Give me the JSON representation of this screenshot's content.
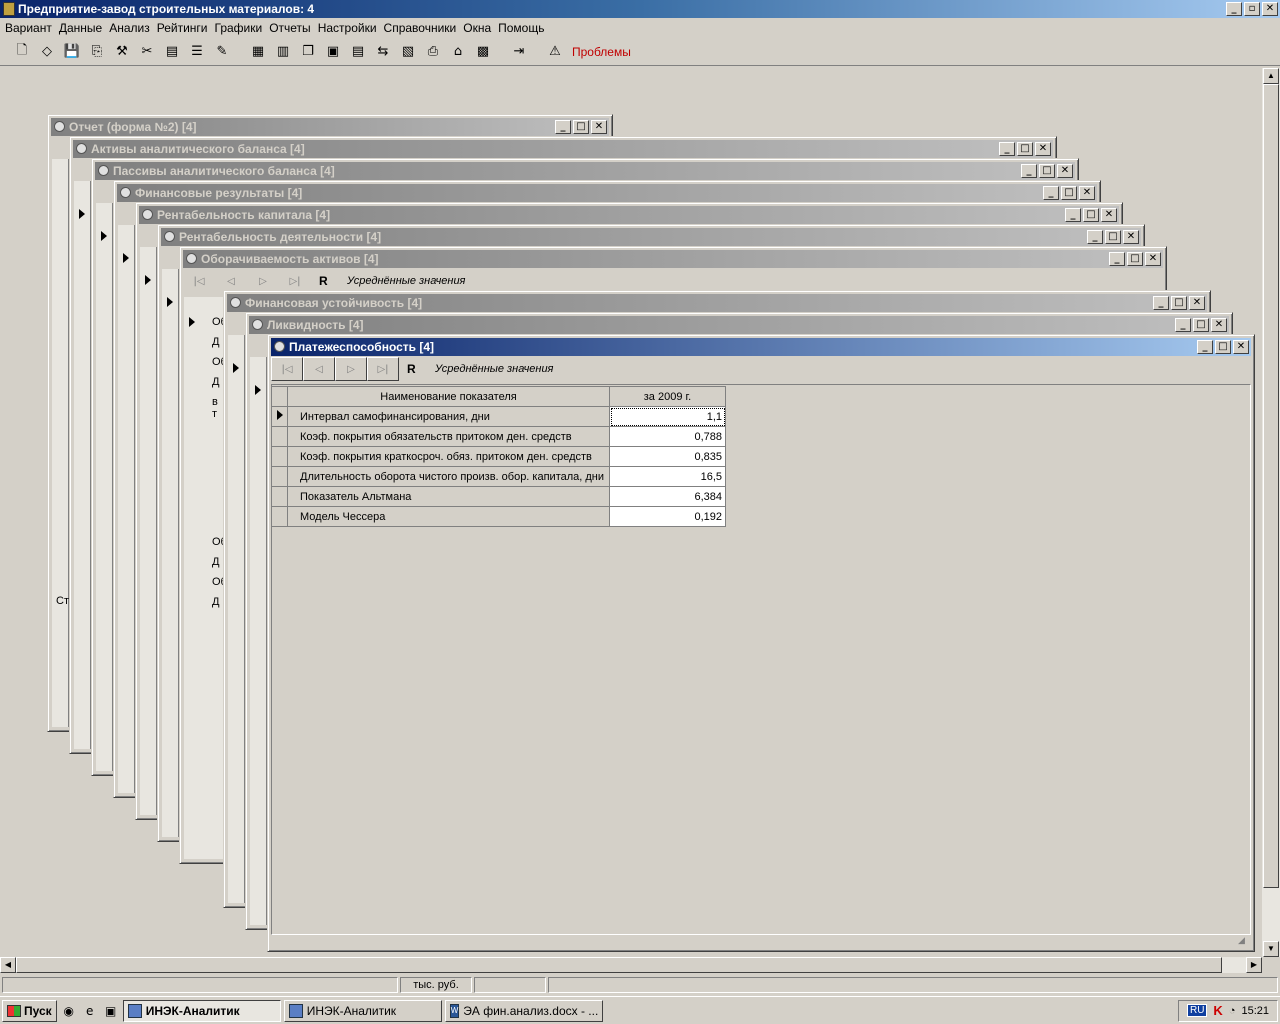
{
  "app": {
    "title": "Предприятие-завод строительных материалов: 4",
    "window_buttons": [
      "_",
      "▫",
      "✕"
    ]
  },
  "menu": [
    "Вариант",
    "Данные",
    "Анализ",
    "Рейтинги",
    "Графики",
    "Отчеты",
    "Настройки",
    "Справочники",
    "Окна",
    "Помощь"
  ],
  "toolbar": {
    "problems_label": "Проблемы"
  },
  "windows": [
    {
      "title": "Отчет (форма №2) [4]"
    },
    {
      "title": "Активы аналитического баланса [4]"
    },
    {
      "title": "Пассивы аналитического баланса [4]"
    },
    {
      "title": "Финансовые результаты [4]"
    },
    {
      "title": "Рентабельность капитала [4]"
    },
    {
      "title": "Рентабельность деятельности [4]"
    },
    {
      "title": "Оборачиваемость активов [4]"
    },
    {
      "title": "Финансовая устойчивость [4]"
    },
    {
      "title": "Ликвидность [4]"
    },
    {
      "title": "Платежеспособность [4]"
    }
  ],
  "navigator": {
    "r_label": "R",
    "mode_text": "Усреднённые значения"
  },
  "grid": {
    "columns": [
      "Наименование показателя",
      "за 2009 г."
    ],
    "rows": [
      {
        "name": "Интервал самофинансирования, дни",
        "value": "1,1"
      },
      {
        "name": "Коэф. покрытия обязательств притоком ден. средств",
        "value": "0,788"
      },
      {
        "name": "Коэф. покрытия краткосроч. обяз. притоком ден. средств",
        "value": "0,835"
      },
      {
        "name": "Длительность оборота чистого произв. обор. капитала, дни",
        "value": "16,5"
      },
      {
        "name": "Показатель Альтмана",
        "value": "6,384"
      },
      {
        "name": "Модель Чессера",
        "value": "0,192"
      }
    ]
  },
  "bg_window_fragments": {
    "oborach": [
      "Об",
      "Д",
      "Об",
      "Д",
      "в т",
      "Об",
      "Д",
      "Об",
      "Д"
    ],
    "otchet": [
      "Ст"
    ]
  },
  "status": {
    "units": "тыс. руб."
  },
  "taskbar": {
    "start": "Пуск",
    "tasks": [
      "ИНЭК-Аналитик",
      "ИНЭК-Аналитик",
      "ЭА фин.анализ.docx - ..."
    ],
    "lang": "RU",
    "time": "15:21"
  }
}
